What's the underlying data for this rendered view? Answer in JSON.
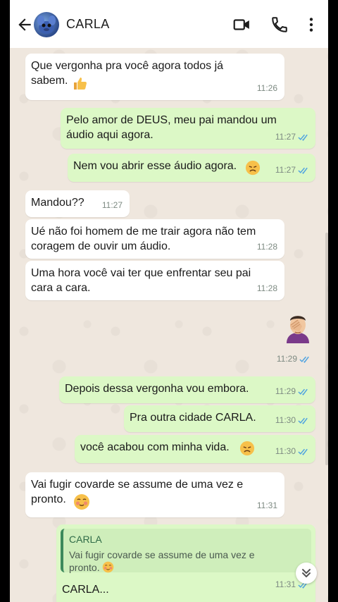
{
  "header": {
    "contact_name": "CARLA",
    "icons": [
      "back-arrow-icon",
      "contact-avatar",
      "video-call-icon",
      "phone-icon",
      "more-menu-icon"
    ]
  },
  "colors": {
    "incoming_bubble": "#ffffff",
    "outgoing_bubble": "#dcf8c6",
    "read_ticks": "#4fa3e0",
    "chat_background": "#efe7de"
  },
  "messages": [
    {
      "dir": "in",
      "text": "Que vergonha pra você agora todos já\nsabem.",
      "emoji": "thumbs-up",
      "time": "11:26"
    },
    {
      "dir": "out",
      "text": "Pelo amor de DEUS, meu pai mandou um\náudio aqui agora.",
      "time": "11:27"
    },
    {
      "dir": "out",
      "text": "Nem vou abrir esse áudio agora.",
      "emoji": "disappointed-face",
      "time": "11:27"
    },
    {
      "dir": "in",
      "text": "Mandou??",
      "time": "11:27"
    },
    {
      "dir": "in",
      "text": "Ué não foi homem de me trair agora não tem\ncoragem de ouvir um áudio.",
      "time": "11:28"
    },
    {
      "dir": "in",
      "text": "Uma hora você vai ter que enfrentar seu pai\ncara a cara.",
      "time": "11:28"
    },
    {
      "dir": "out",
      "text": "",
      "emoji": "facepalm-sticker",
      "time": "11:29"
    },
    {
      "dir": "out",
      "text": "Depois dessa vergonha vou embora.",
      "time": "11:29"
    },
    {
      "dir": "out",
      "text": "Pra outra cidade CARLA.",
      "time": "11:30"
    },
    {
      "dir": "out",
      "text": "você acabou com minha vida.",
      "emoji": "disappointed-face",
      "time": "11:30"
    },
    {
      "dir": "in",
      "text": "Vai fugir covarde se assume de uma vez e\npronto.",
      "emoji": "blushing-face",
      "time": "11:31"
    },
    {
      "dir": "out",
      "quote": {
        "name": "CARLA",
        "text": "Vai fugir covarde se assume de uma vez e\npronto."
      },
      "text": "CARLA...",
      "time": "11:31"
    }
  ]
}
